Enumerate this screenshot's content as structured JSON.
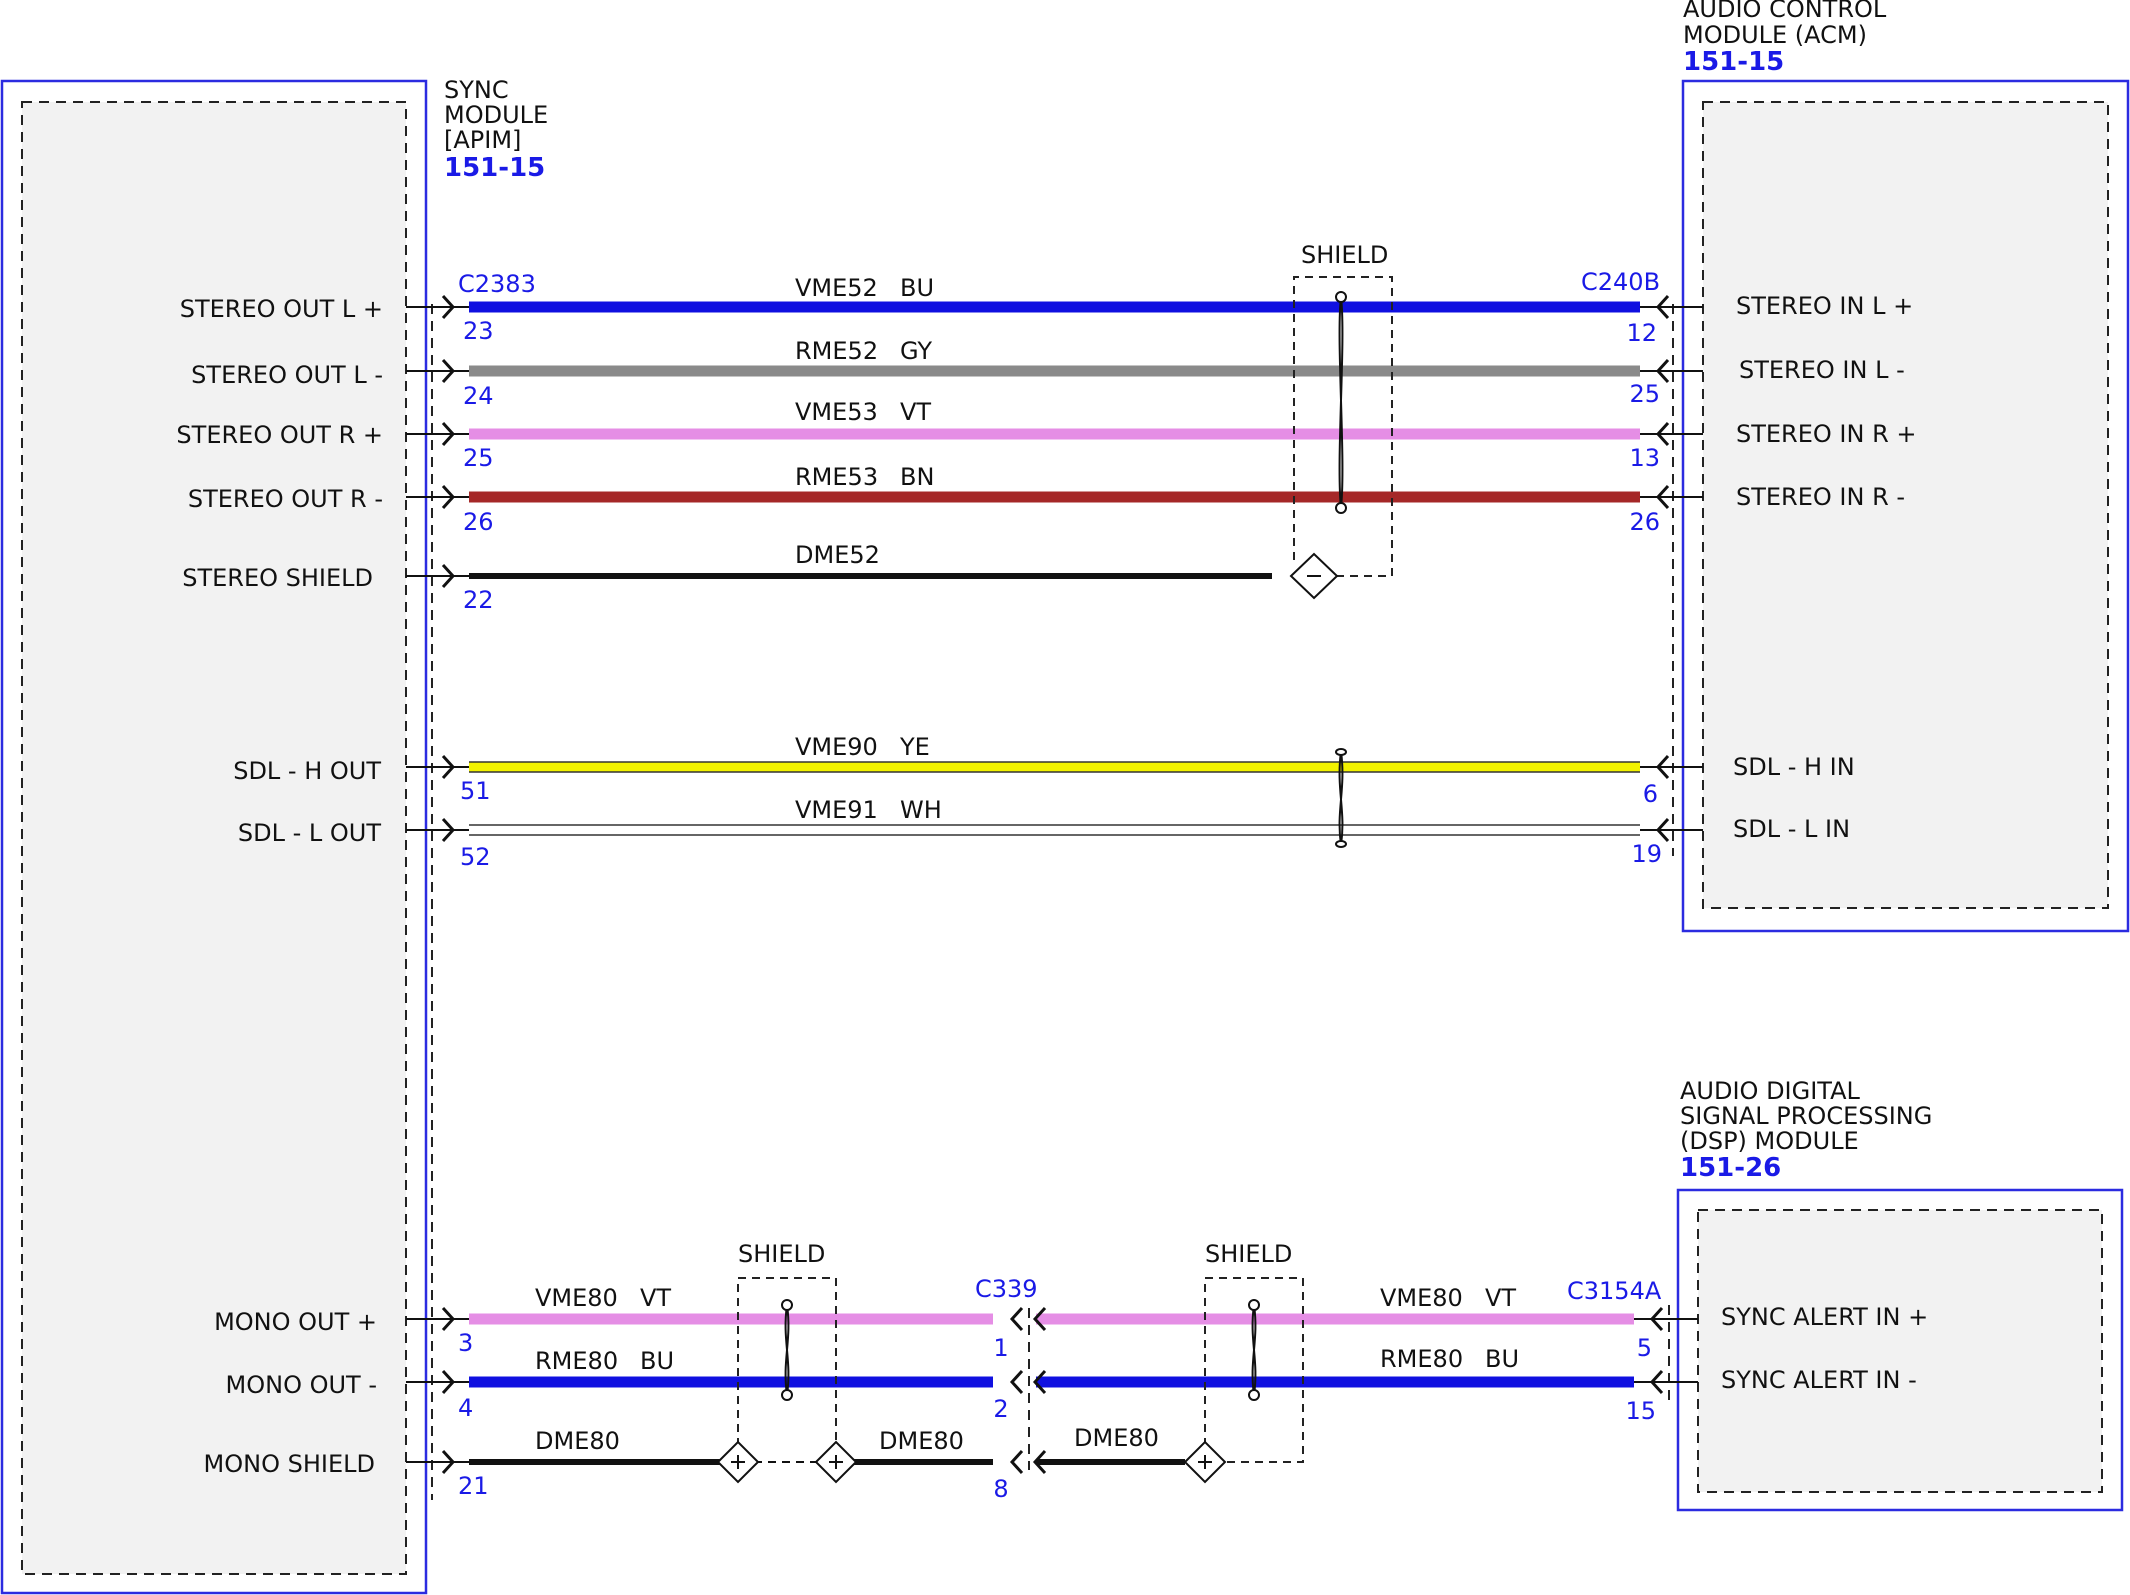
{
  "modules": {
    "sync": {
      "name_lines": [
        "SYNC",
        "MODULE",
        "[APIM]"
      ],
      "ref": "151-15"
    },
    "acm": {
      "name_lines": [
        "AUDIO CONTROL",
        "MODULE (ACM)"
      ],
      "ref": "151-15"
    },
    "dsp": {
      "name_lines": [
        "AUDIO DIGITAL",
        "SIGNAL PROCESSING",
        "(DSP) MODULE"
      ],
      "ref": "151-26"
    }
  },
  "connectors": {
    "c2383": "C2383",
    "c240b": "C240B",
    "c339": "C339",
    "c3154a": "C3154A"
  },
  "sync_pins": [
    {
      "label": "STEREO OUT L +",
      "pin": "23"
    },
    {
      "label": "STEREO OUT L -",
      "pin": "24"
    },
    {
      "label": "STEREO OUT R +",
      "pin": "25"
    },
    {
      "label": "STEREO OUT R -",
      "pin": "26"
    },
    {
      "label": "STEREO SHIELD",
      "pin": "22"
    },
    {
      "label": "SDL - H OUT",
      "pin": "51"
    },
    {
      "label": "SDL - L OUT",
      "pin": "52"
    },
    {
      "label": "MONO OUT +",
      "pin": "3"
    },
    {
      "label": "MONO OUT -",
      "pin": "4"
    },
    {
      "label": "MONO SHIELD",
      "pin": "21"
    }
  ],
  "acm_pins": [
    {
      "label": "STEREO IN L +",
      "pin": "12"
    },
    {
      "label": "STEREO IN L -",
      "pin": "25"
    },
    {
      "label": "STEREO IN R +",
      "pin": "13"
    },
    {
      "label": "STEREO IN R -",
      "pin": "26"
    },
    {
      "label": "SDL - H IN",
      "pin": "6"
    },
    {
      "label": "SDL - L IN",
      "pin": "19"
    }
  ],
  "dsp_pins": [
    {
      "label": "SYNC ALERT IN +",
      "pin": "5"
    },
    {
      "label": "SYNC ALERT IN -",
      "pin": "15"
    }
  ],
  "c339_pins": [
    "1",
    "2",
    "8"
  ],
  "wires": [
    {
      "circuit": "VME52",
      "color_code": "BU",
      "color": "#1010e0"
    },
    {
      "circuit": "RME52",
      "color_code": "GY",
      "color": "#8a8a8a"
    },
    {
      "circuit": "VME53",
      "color_code": "VT",
      "color": "#e58ee5"
    },
    {
      "circuit": "RME53",
      "color_code": "BN",
      "color": "#a52828"
    },
    {
      "circuit": "DME52",
      "color_code": "",
      "color": "#111111"
    },
    {
      "circuit": "VME90",
      "color_code": "YE",
      "color": "#f2f200"
    },
    {
      "circuit": "VME91",
      "color_code": "WH",
      "color": "#ffffff"
    },
    {
      "circuit": "VME80",
      "color_code": "VT",
      "color": "#e58ee5"
    },
    {
      "circuit": "RME80",
      "color_code": "BU",
      "color": "#1010e0"
    },
    {
      "circuit": "DME80",
      "color_code": "",
      "color": "#111111"
    }
  ],
  "shield_label": "SHIELD"
}
